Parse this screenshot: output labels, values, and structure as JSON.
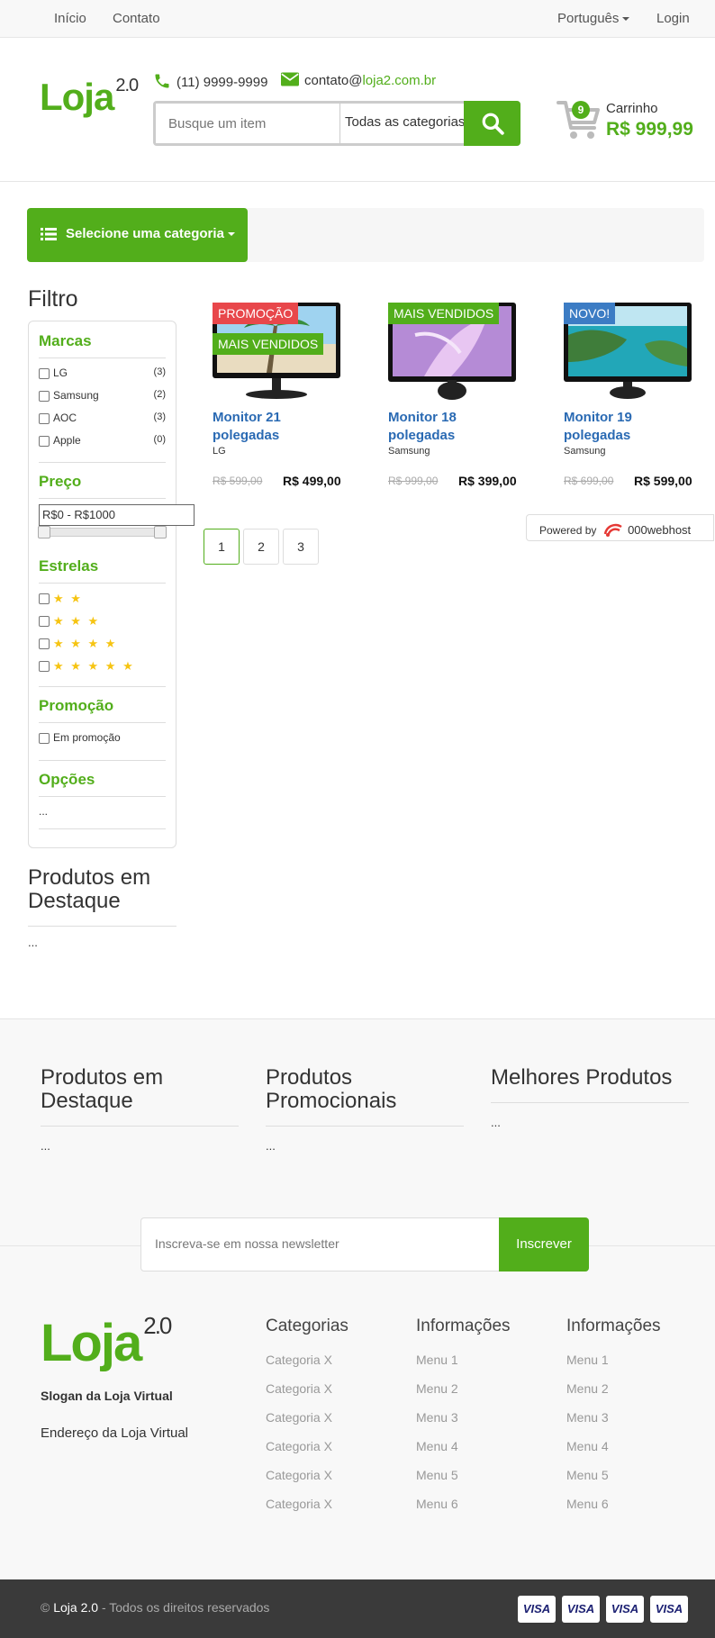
{
  "topbar": {
    "nav": [
      "Início",
      "Contato"
    ],
    "language": "Português",
    "login": "Login"
  },
  "header": {
    "logo_text": "Loja",
    "logo_version": "2.0",
    "phone": "(11) 9999-9999",
    "email_prefix": "contato@",
    "email_domain": "loja2.com.br",
    "search_placeholder": "Busque um item",
    "category_select": "Todas as categorias",
    "cart_count": "9",
    "cart_label": "Carrinho",
    "cart_total": "R$ 999,99"
  },
  "category_button": "Selecione uma categoria",
  "filter": {
    "title": "Filtro",
    "brands_title": "Marcas",
    "brands": [
      {
        "name": "LG",
        "count": "(3)"
      },
      {
        "name": "Samsung",
        "count": "(2)"
      },
      {
        "name": "AOC",
        "count": "(3)"
      },
      {
        "name": "Apple",
        "count": "(0)"
      }
    ],
    "price_title": "Preço",
    "price_range": "R$0 - R$1000",
    "stars_title": "Estrelas",
    "stars": [
      "★ ★",
      "★ ★ ★",
      "★ ★ ★ ★",
      "★ ★ ★ ★ ★"
    ],
    "promo_title": "Promoção",
    "promo_option": "Em promoção",
    "options_title": "Opções",
    "options_value": "..."
  },
  "sidebar_featured": {
    "title": "Produtos em Destaque",
    "value": "..."
  },
  "products": [
    {
      "tags": [
        "PROMOÇÃO",
        "MAIS VENDIDOS"
      ],
      "name": "Monitor 21 polegadas",
      "brand": "LG",
      "old_price": "R$ 599,00",
      "price": "R$ 499,00"
    },
    {
      "tags": [
        "MAIS VENDIDOS"
      ],
      "name": "Monitor 18 polegadas",
      "brand": "Samsung",
      "old_price": "R$ 999,00",
      "price": "R$ 399,00"
    },
    {
      "tags": [
        "NOVO!"
      ],
      "name": "Monitor 19 polegadas",
      "brand": "Samsung",
      "old_price": "R$ 699,00",
      "price": "R$ 599,00"
    }
  ],
  "pagination": [
    "1",
    "2",
    "3"
  ],
  "powered_by": {
    "label": "Powered by",
    "brand": "000webhost"
  },
  "footer_sections": [
    {
      "title": "Produtos em Destaque",
      "value": "..."
    },
    {
      "title": "Produtos Promocionais",
      "value": "..."
    },
    {
      "title": "Melhores Produtos",
      "value": "..."
    }
  ],
  "newsletter": {
    "placeholder": "Inscreva-se em nossa newsletter",
    "button": "Inscrever"
  },
  "footer": {
    "slogan": "Slogan da Loja Virtual",
    "address": "Endereço da Loja Virtual",
    "columns": [
      {
        "title": "Categorias",
        "items": [
          "Categoria X",
          "Categoria X",
          "Categoria X",
          "Categoria X",
          "Categoria X",
          "Categoria X"
        ]
      },
      {
        "title": "Informações",
        "items": [
          "Menu 1",
          "Menu 2",
          "Menu 3",
          "Menu 4",
          "Menu 5",
          "Menu 6"
        ]
      },
      {
        "title": "Informações",
        "items": [
          "Menu 1",
          "Menu 2",
          "Menu 3",
          "Menu 4",
          "Menu 5",
          "Menu 6"
        ]
      }
    ],
    "copyright_symbol": "©",
    "copyright_brand": "Loja 2.0",
    "copyright_text": "- Todos os direitos reservados",
    "payment_cards": [
      "VISA",
      "VISA",
      "VISA",
      "VISA"
    ]
  },
  "colors": {
    "accent": "#52ae1b",
    "link": "#2a6ab3",
    "promo_tag": "#e8474b",
    "new_tag": "#3c7cc4",
    "star": "#f6c412",
    "footer_bottom": "#3a3a3a"
  }
}
